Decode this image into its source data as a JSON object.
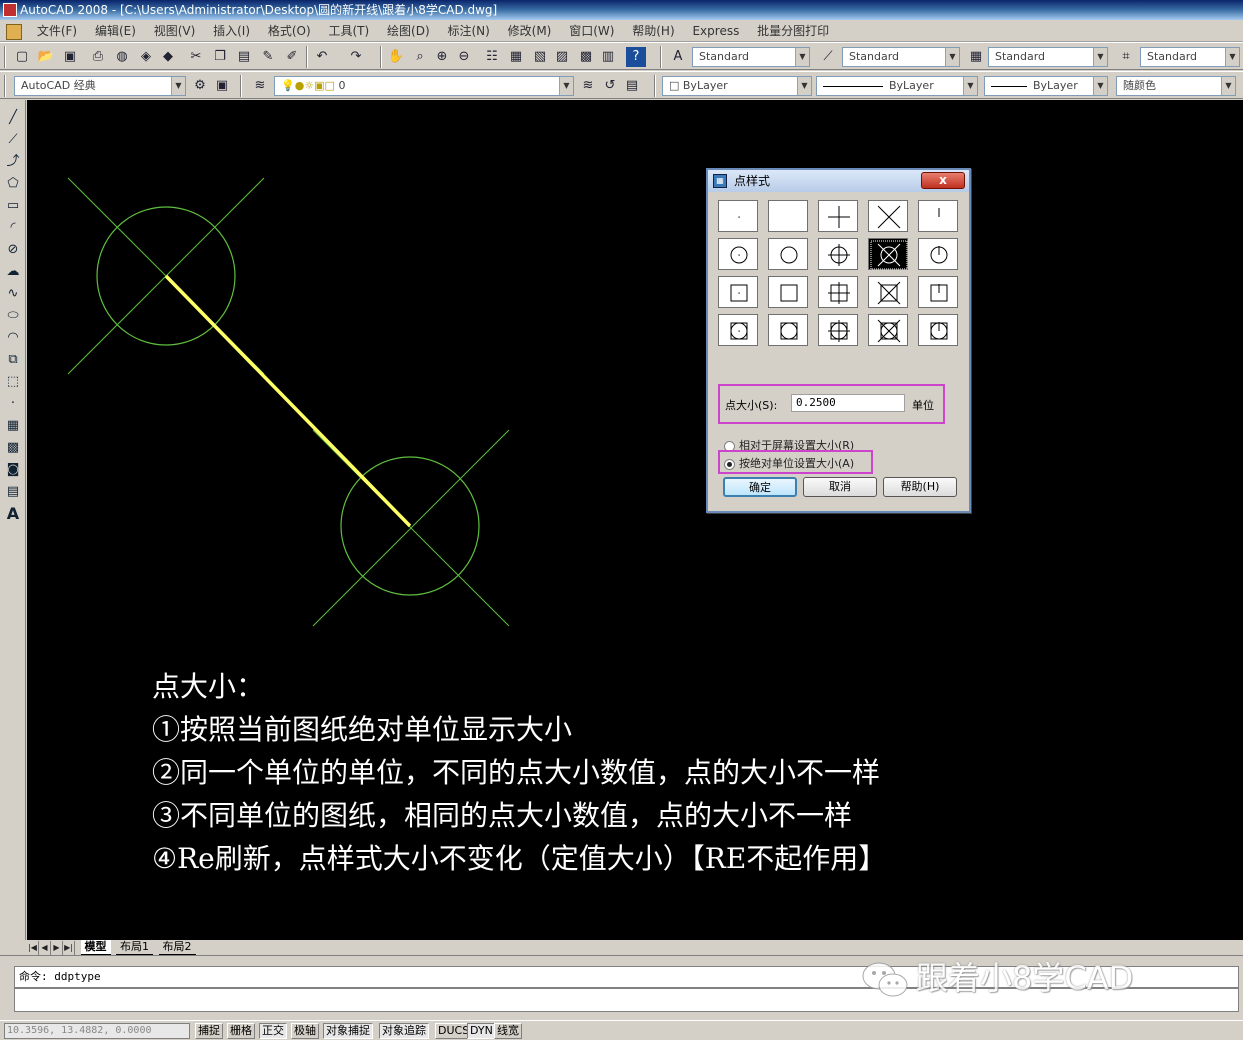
{
  "window": {
    "title": "AutoCAD 2008 - [C:\\Users\\Administrator\\Desktop\\圆的新开线\\跟着小8学CAD.dwg]"
  },
  "menu": {
    "items": [
      "文件(F)",
      "编辑(E)",
      "视图(V)",
      "插入(I)",
      "格式(O)",
      "工具(T)",
      "绘图(D)",
      "标注(N)",
      "修改(M)",
      "窗口(W)",
      "帮助(H)",
      "Express",
      "批量分图打印"
    ]
  },
  "toolbar1": {
    "text_style": "Standard",
    "dim_style": "Standard",
    "table_style": "Standard",
    "mleader_style": "Standard"
  },
  "toolbar2": {
    "workspace": "AutoCAD 经典",
    "layer": "0",
    "color": "ByLayer",
    "linetype": "ByLayer",
    "lineweight": "ByLayer",
    "plotstyle": "随颜色"
  },
  "notes": {
    "lines": [
      "点大小：",
      "①按照当前图纸绝对单位显示大小",
      "②同一个单位的单位，不同的点大小数值，点的大小不一样",
      "③不同单位的图纸，相同的点大小数值，点的大小不一样",
      "④Re刷新，点样式大小不变化（定值大小）【RE不起作用】"
    ]
  },
  "dialog": {
    "title": "点样式",
    "close_label": "x",
    "selected_style_index": 8,
    "size_label": "点大小(S):",
    "size_value": "0.2500",
    "size_unit": "单位",
    "radio_relative": "相对于屏幕设置大小(R)",
    "radio_absolute": "按绝对单位设置大小(A)",
    "selected_mode": "absolute",
    "ok_label": "确定",
    "cancel_label": "取消",
    "help_label": "帮助(H)"
  },
  "tabs": {
    "model": "模型",
    "layout1": "布局1",
    "layout2": "布局2"
  },
  "command": {
    "prompt": "命令: ddptype",
    "watermark": "跟着小8学CAD"
  },
  "status": {
    "coords": "10.3596,  13.4882,  0.0000",
    "buttons": [
      "捕捉",
      "栅格",
      "正交",
      "极轴",
      "对象捕捉",
      "对象追踪",
      "DUCS",
      "DYN",
      "线宽"
    ]
  },
  "colors": {
    "canvas_bg": "#000000",
    "circle_line": "#5fbf3f",
    "highlight_line": "#ffff66",
    "annotation_box": "#cc44cc"
  }
}
